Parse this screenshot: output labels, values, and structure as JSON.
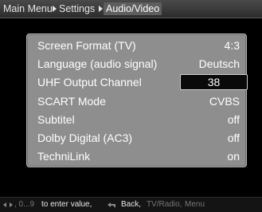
{
  "breadcrumb": {
    "items": [
      "Main Menu",
      "Settings",
      "Audio/Video"
    ]
  },
  "settings": [
    {
      "label": "Screen Format (TV)",
      "value": "4:3"
    },
    {
      "label": "Language (audio signal)",
      "value": "Deutsch"
    },
    {
      "label": "UHF Output Channel",
      "value": "38"
    },
    {
      "label": "SCART Mode",
      "value": "CVBS"
    },
    {
      "label": "Subtitel",
      "value": "off"
    },
    {
      "label": "Dolby Digital (AC3)",
      "value": "off"
    },
    {
      "label": "TechniLink",
      "value": "on"
    }
  ],
  "help": {
    "range": ", 0...9",
    "enter_value": "to enter value,",
    "back": "Back,",
    "tv_radio": "TV/Radio,",
    "menu": "Menu"
  }
}
